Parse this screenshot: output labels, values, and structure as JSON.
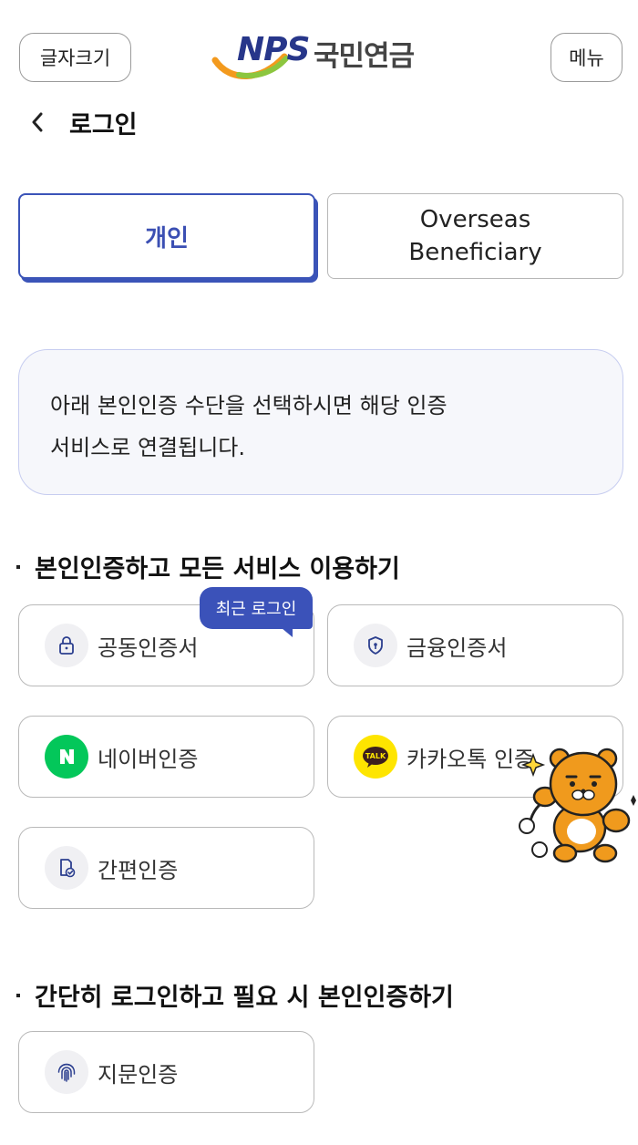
{
  "header": {
    "font_size_label": "글자크기",
    "menu_label": "메뉴",
    "logo_text_en": "NPS",
    "logo_text_ko": "국민연금"
  },
  "title_bar": {
    "back_icon": "chevron-left-icon",
    "title": "로그인"
  },
  "tabs": [
    {
      "label": "개인",
      "selected": true
    },
    {
      "label_line1": "Overseas",
      "label_line2": "Beneficiary",
      "selected": false
    }
  ],
  "notice": {
    "line1": "아래 본인인증 수단을 선택하시면 해당 인증",
    "line2": "서비스로 연결됩니다."
  },
  "section1": {
    "title": "본인인증하고 모든 서비스 이용하기",
    "recent_badge": "최근 로그인",
    "items": [
      {
        "label": "공동인증서",
        "icon": "lock-icon"
      },
      {
        "label": "금융인증서",
        "icon": "shield-icon"
      },
      {
        "label": "네이버인증",
        "icon": "naver-icon"
      },
      {
        "label": "카카오톡 인증",
        "icon": "kakao-talk-icon"
      },
      {
        "label": "간편인증",
        "icon": "phone-check-icon"
      }
    ]
  },
  "section2": {
    "title": "간단히 로그인하고 필요 시 본인인증하기",
    "items": [
      {
        "label": "지문인증",
        "icon": "fingerprint-icon"
      }
    ]
  },
  "colors": {
    "accent": "#3b52b9",
    "naver_green": "#03c75a",
    "kakao_yellow": "#fee500",
    "logo_navy": "#27368a"
  }
}
